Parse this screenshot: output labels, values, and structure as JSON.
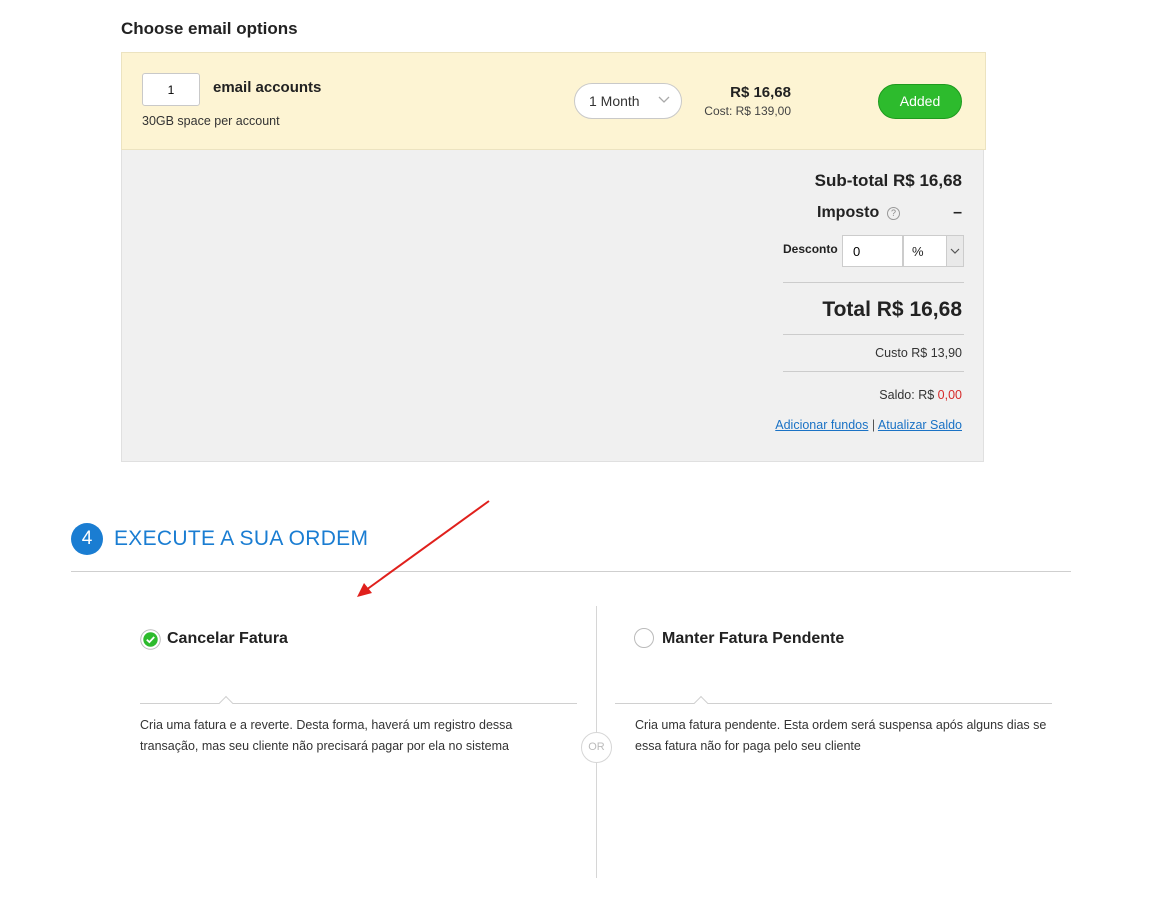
{
  "email_options": {
    "title": "Choose email options",
    "quantity": "1",
    "accounts_label": "email accounts",
    "space_note": "30GB space per account",
    "period": "1 Month",
    "price": "R$ 16,68",
    "cost": "Cost: R$ 139,00",
    "added_label": "Added"
  },
  "totals": {
    "subtotal": "Sub-total R$ 16,68",
    "imposto_label": "Imposto",
    "imposto_help": "?",
    "imposto_value": "–",
    "desconto_label": "Desconto",
    "desconto_value": "0",
    "desconto_unit": "%",
    "total": "Total R$ 16,68",
    "custo": "Custo R$ 13,90",
    "saldo_label": "Saldo: R$ ",
    "saldo_value": "0,00",
    "link_add_funds": "Adicionar fundos",
    "link_separator": "|",
    "link_refresh": "Atualizar Saldo"
  },
  "step": {
    "number": "4",
    "title": "EXECUTE A SUA ORDEM"
  },
  "options": {
    "or_label": "OR",
    "cancel": {
      "title": "Cancelar Fatura",
      "desc_line1": "Cria uma fatura e a reverte. Desta forma, haverá um registro dessa",
      "desc_line2": "transação, mas seu cliente não precisará pagar por ela no sistema",
      "selected": true
    },
    "pending": {
      "title": "Manter Fatura Pendente",
      "desc_line1": "Cria uma fatura pendente. Esta ordem será suspensa após alguns dias se",
      "desc_line2": "essa fatura não for paga pelo seu cliente",
      "selected": false
    }
  },
  "colors": {
    "accent_blue": "#1a7dd2",
    "added_green": "#2dbb2d",
    "annotation_red": "#e0201c",
    "saldo_red": "#d62b2b"
  }
}
